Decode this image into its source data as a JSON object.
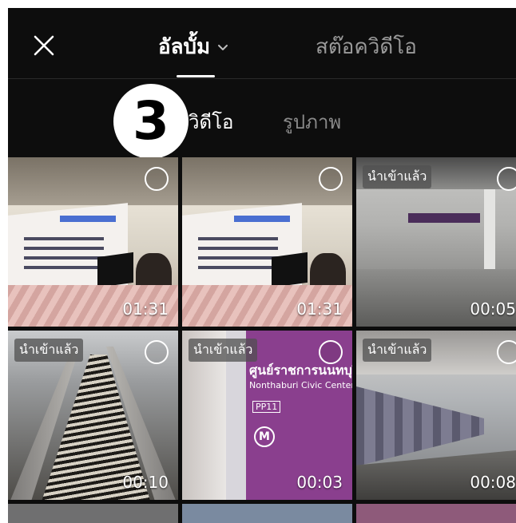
{
  "header": {
    "tab_album": "อัลบั้ม",
    "tab_stock": "สต๊อควิดีโอ"
  },
  "step_badge": "3",
  "filters": {
    "video": "วิดีโอ",
    "photo": "รูปภาพ"
  },
  "grid": {
    "imported_label": "นำเข้าแล้ว",
    "items": [
      {
        "duration": "01:31",
        "imported": false
      },
      {
        "duration": "01:31",
        "imported": false
      },
      {
        "duration": "00:05",
        "imported": true
      },
      {
        "duration": "00:10",
        "imported": true
      },
      {
        "duration": "00:03",
        "imported": true
      },
      {
        "duration": "00:08",
        "imported": true
      }
    ],
    "thumb_text": {
      "station_name_th": "ศูนย์ราชการนนทบุรี",
      "station_name_en": "Nonthaburi Civic Center",
      "station_code": "PP11",
      "metro_mark": "M"
    }
  },
  "colors": {
    "background": "#0d0d0d",
    "active_text": "#ffffff",
    "inactive_text": "#9a9a9a"
  },
  "icons": [
    "close-icon",
    "chevron-down-icon",
    "select-circle-icon"
  ]
}
